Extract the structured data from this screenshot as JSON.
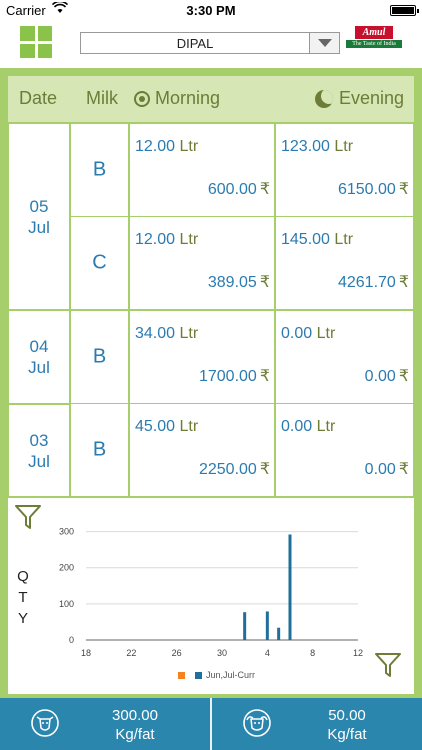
{
  "status": {
    "carrier": "Carrier",
    "time": "3:30 PM"
  },
  "header": {
    "selected_customer": "DIPAL",
    "logo_brand": "Amul",
    "logo_tagline": "The Taste of India"
  },
  "columns": {
    "date": "Date",
    "milk": "Milk",
    "morning": "Morning",
    "evening": "Evening"
  },
  "currency_symbol": "₹",
  "rows": [
    {
      "date_day": "05",
      "date_month": "Jul",
      "type": "B",
      "morning_qty": "12.00",
      "morning_unit": "Ltr",
      "morning_amount": "600.00",
      "evening_qty": "123.00",
      "evening_unit": "Ltr",
      "evening_amount": "6150.00"
    },
    {
      "type": "C",
      "morning_qty": "12.00",
      "morning_unit": "Ltr",
      "morning_amount": "389.05",
      "evening_qty": "145.00",
      "evening_unit": "Ltr",
      "evening_amount": "4261.70"
    },
    {
      "date_day": "04",
      "date_month": "Jul",
      "type": "B",
      "morning_qty": "34.00",
      "morning_unit": "Ltr",
      "morning_amount": "1700.00",
      "evening_qty": "0.00",
      "evening_unit": "Ltr",
      "evening_amount": "0.00"
    },
    {
      "date_day": "03",
      "date_month": "Jul",
      "type": "B",
      "morning_qty": "45.00",
      "morning_unit": "Ltr",
      "morning_amount": "2250.00",
      "evening_qty": "0.00",
      "evening_unit": "Ltr",
      "evening_amount": "0.00"
    }
  ],
  "chart_ylabel": [
    "Q",
    "T",
    "Y"
  ],
  "chart_data": {
    "type": "bar",
    "x_ticks": [
      "18",
      "22",
      "26",
      "30",
      "4",
      "8",
      "12"
    ],
    "y_ticks": [
      "0",
      "100",
      "200",
      "300"
    ],
    "ylim": [
      0,
      310
    ],
    "series": [
      {
        "name": "",
        "color": "#f5821f",
        "values": []
      },
      {
        "name": "Jun,Jul-Curr",
        "color": "#1f6f9a",
        "points": [
          {
            "x": "Jul 1",
            "y": 77
          },
          {
            "x": "Jul 3",
            "y": 79
          },
          {
            "x": "Jul 4",
            "y": 34
          },
          {
            "x": "Jul 5",
            "y": 292
          }
        ]
      }
    ],
    "grid": "horizontal",
    "legend": "bottom-center"
  },
  "footer": {
    "cow": {
      "value": "300.00",
      "unit": "Kg/fat",
      "icon": "cow-icon"
    },
    "buffalo": {
      "value": "50.00",
      "unit": "Kg/fat",
      "icon": "buffalo-icon"
    }
  },
  "colors": {
    "accent_green": "#a6cf6c",
    "header_green": "#d6e6b4",
    "text_blue": "#2b7bb0",
    "text_olive": "#6d7d38",
    "footer_blue": "#2b86ae"
  }
}
